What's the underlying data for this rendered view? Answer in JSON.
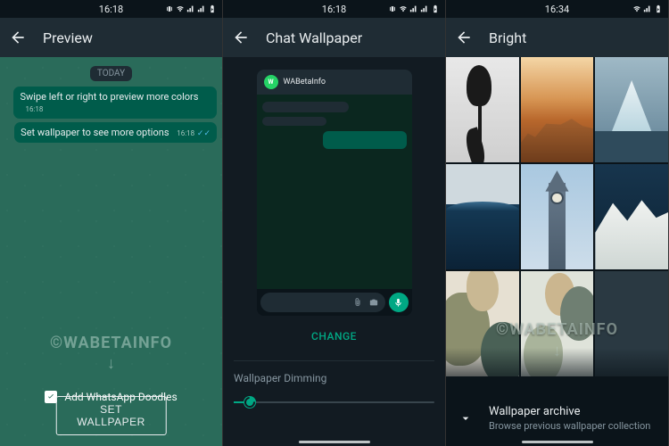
{
  "status": {
    "time1": "16:18",
    "time3": "16:34"
  },
  "screen1": {
    "header": "Preview",
    "date": "TODAY",
    "msg1": "Swipe left or right to preview more colors",
    "msg1_ts": "16:18",
    "msg2": "Set wallpaper to see more options",
    "msg2_ts": "16:18",
    "watermark": "©WABETAINFO",
    "doodle_label": "Add WhatsApp Doodles",
    "set_button": "SET WALLPAPER"
  },
  "screen2": {
    "header": "Chat Wallpaper",
    "contact": "WABetaInfo",
    "change": "CHANGE",
    "dim_label": "Wallpaper Dimming"
  },
  "screen3": {
    "header": "Bright",
    "watermark": "©WABETAINFO",
    "archive_title": "Wallpaper archive",
    "archive_sub": "Browse previous wallpaper collection"
  }
}
